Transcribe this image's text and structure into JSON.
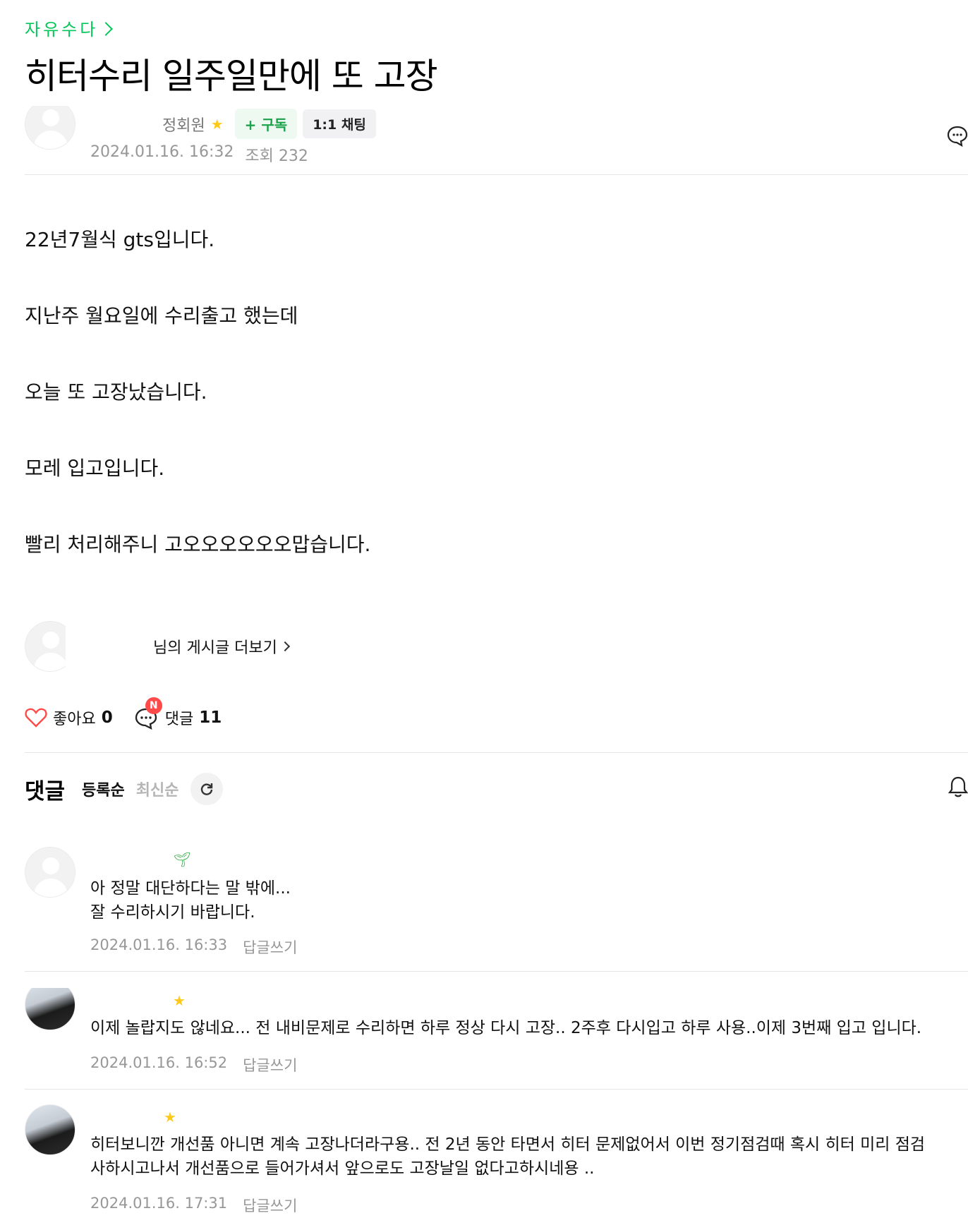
{
  "board": {
    "name": "자유수다"
  },
  "post": {
    "title": "히터수리 일주일만에 또 고장",
    "author": {
      "level": "정회원",
      "subscribe_label": "+ 구독",
      "chat_label": "1:1 채팅"
    },
    "date": "2024.01.16. 16:32",
    "views": "조회 232",
    "paragraphs": [
      "22년7월식 gts입니다.",
      "지난주 월요일에 수리출고 했는데",
      "오늘 또 고장났습니다.",
      "모레 입고입니다.",
      "빨리 처리해주니 고오오오오오오맙습니다."
    ],
    "more_posts_label": "님의 게시글 더보기",
    "like_label": "좋아요",
    "like_count": "0",
    "comment_label": "댓글",
    "comment_count": "11",
    "new_badge": "N"
  },
  "comments_section": {
    "heading": "댓글",
    "sort_registered": "등록순",
    "sort_latest": "최신순"
  },
  "comments": [
    {
      "badge_icon": "sprout-icon",
      "lines": [
        "아 정말 대단하다는 말 밖에...",
        "잘 수리하시기 바랍니다."
      ],
      "date": "2024.01.16. 16:33",
      "reply_label": "답글쓰기"
    },
    {
      "badge_icon": "star-icon",
      "lines": [
        "이제 놀랍지도 않네요... 전 내비문제로 수리하면 하루 정상 다시 고장.. 2주후 다시입고 하루 사용..이제 3번째 입고 입니다."
      ],
      "date": "2024.01.16. 16:52",
      "reply_label": "답글쓰기"
    },
    {
      "badge_icon": "star-icon",
      "lines": [
        "히터보니깐 개선품 아니면 계속 고장나더라구용.. 전 2년 동안 타면서 히터 문제없어서 이번 정기점검때 혹시 히터 미리 점검",
        "사하시고나서 개선품으로 들어가셔서 앞으로도 고장날일 없다고하시네용 .."
      ],
      "date": "2024.01.16. 17:31",
      "reply_label": "답글쓰기"
    }
  ],
  "colors": {
    "accent": "#03c75a",
    "meta": "#979797",
    "like": "#ff4a4a"
  }
}
